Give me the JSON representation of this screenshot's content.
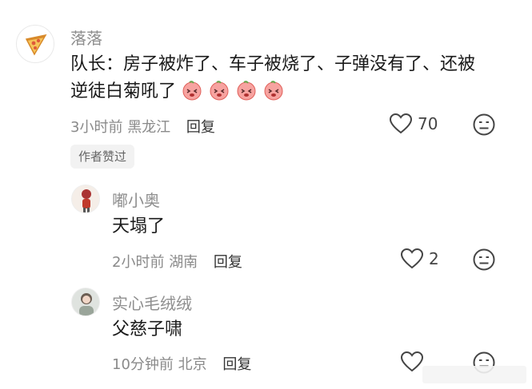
{
  "comment": {
    "username": "落落",
    "text_line1": "队长：房子被炸了、车子被烧了、子弹没有了、还被",
    "text_line2": "逆徒白菊吼了",
    "emoji_icon": "crying-peach-emoji",
    "time": "3小时前",
    "location": "黑龙江",
    "reply_label": "回复",
    "like_count": "70",
    "author_badge": "作者赞过"
  },
  "replies": [
    {
      "username": "嘟小奥",
      "text": "天塌了",
      "time": "2小时前",
      "location": "湖南",
      "reply_label": "回复",
      "like_count": "2"
    },
    {
      "username": "实心毛绒绒",
      "text": "父慈子啸",
      "time": "10分钟前",
      "location": "北京",
      "reply_label": "回复",
      "like_count": ""
    }
  ],
  "colors": {
    "name": "#8e8e8e",
    "text": "#1a1a1a",
    "meta": "#8a8a8a",
    "badge_bg": "#f2f2f2"
  }
}
